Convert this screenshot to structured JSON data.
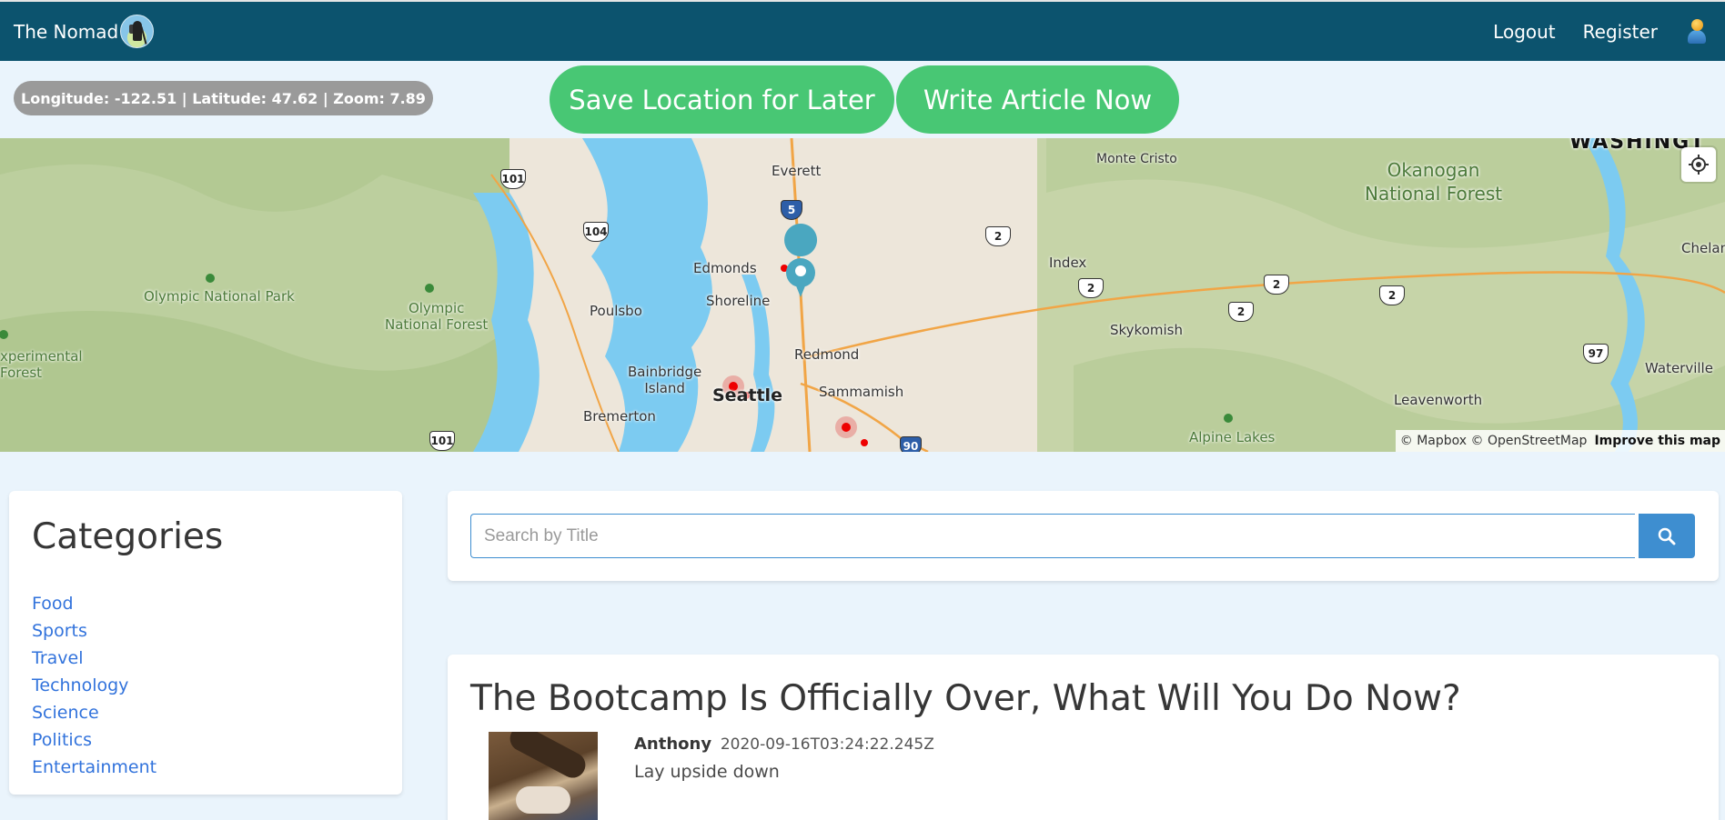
{
  "navbar": {
    "brand": "The Nomad",
    "links": [
      {
        "label": "Logout"
      },
      {
        "label": "Register"
      }
    ]
  },
  "map_controls": {
    "coords_text": "Longitude: -122.51 | Latitude: 47.62 | Zoom: 7.89",
    "save_button": "Save Location for Later",
    "write_button": "Write Article Now"
  },
  "map": {
    "labels": {
      "everett": "Everett",
      "monte_cristo": "Monte Cristo",
      "okanogan": "Okanogan\nNational Forest",
      "washington": "WASHINGT",
      "edmonds": "Edmonds",
      "shoreline": "Shoreline",
      "poulsbo": "Poulsbo",
      "index": "Index",
      "chelan": "Chelan",
      "olympic_np": "Olympic National Park",
      "olympic_nf": "Olympic\nNational Forest",
      "experimental": "xperimental\nForest",
      "skykomish": "Skykomish",
      "redmond": "Redmond",
      "bainbridge": "Bainbridge\nIsland",
      "seattle": "Seattle",
      "sammamish": "Sammamish",
      "bremerton": "Bremerton",
      "waterville": "Waterville",
      "leavenworth": "Leavenworth",
      "alpine_lakes": "Alpine Lakes"
    },
    "shields": [
      "101",
      "104",
      "5",
      "2",
      "2",
      "2",
      "2",
      "2",
      "97",
      "101",
      "90"
    ],
    "attribution": "© Mapbox © OpenStreetMap",
    "improve": "Improve this map"
  },
  "sidebar": {
    "title": "Categories",
    "items": [
      "Food",
      "Sports",
      "Travel",
      "Technology",
      "Science",
      "Politics",
      "Entertainment"
    ]
  },
  "search": {
    "placeholder": "Search by Title"
  },
  "article": {
    "title": "The Bootcamp Is Officially Over, What Will You Do Now?",
    "author": "Anthony",
    "date": "2020-09-16T03:24:22.245Z",
    "excerpt": "Lay upside down"
  },
  "colors": {
    "navbar": "#0c536e",
    "button_green": "#48c774",
    "link_blue": "#3273dc",
    "search_blue": "#3e8ed0",
    "background": "#eaf4fc"
  }
}
